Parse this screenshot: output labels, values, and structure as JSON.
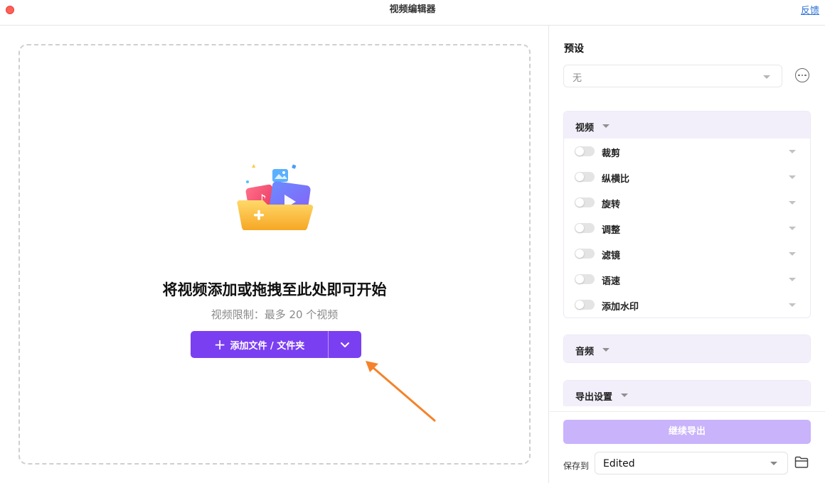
{
  "window": {
    "title": "视频编辑器",
    "feedback_label": "反馈"
  },
  "dropzone": {
    "title": "将视频添加或拖拽至此处即可开始",
    "subtitle": "视频限制：最多 20 个视频",
    "add_button_label": "添加文件 / 文件夹"
  },
  "preset": {
    "label": "预设",
    "value": "无"
  },
  "sections": {
    "video": {
      "label": "视频",
      "items": [
        {
          "label": "裁剪",
          "enabled": false
        },
        {
          "label": "纵横比",
          "enabled": false
        },
        {
          "label": "旋转",
          "enabled": false
        },
        {
          "label": "调整",
          "enabled": false
        },
        {
          "label": "滤镜",
          "enabled": false
        },
        {
          "label": "语速",
          "enabled": false
        },
        {
          "label": "添加水印",
          "enabled": false
        }
      ]
    },
    "audio": {
      "label": "音频"
    },
    "export_settings": {
      "label": "导出设置"
    }
  },
  "footer": {
    "export_label": "继续导出",
    "save_to_label": "保存到",
    "save_to_value": "Edited"
  },
  "colors": {
    "accent": "#7b3ff2",
    "accent_disabled": "#c9b3fb",
    "annotation_arrow": "#f5822a"
  }
}
